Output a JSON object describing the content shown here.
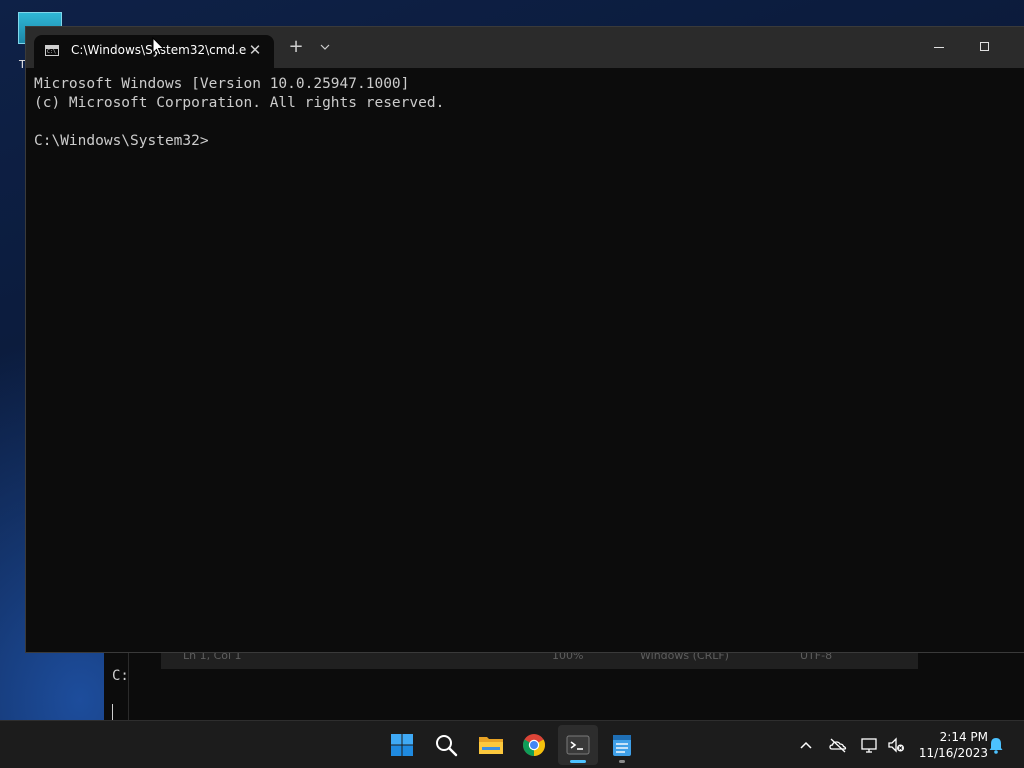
{
  "desktop": {
    "icon_label": "T"
  },
  "background": {
    "cmd_prompt": "C:",
    "notepad_status": {
      "position": "Ln 1, Col 1",
      "zoom": "100%",
      "line_ending": "Windows (CRLF)",
      "encoding": "UTF-8"
    }
  },
  "terminal": {
    "tab_title": "C:\\Windows\\System32\\cmd.e",
    "tab_icon_text": "C:\\",
    "close_tab_glyph": "✕",
    "new_tab_glyph": "+",
    "lines": [
      "Microsoft Windows [Version 10.0.25947.1000]",
      "(c) Microsoft Corporation. All rights reserved.",
      "",
      "C:\\Windows\\System32>"
    ]
  },
  "taskbar": {
    "icons": [
      "windows-start-icon",
      "search-icon",
      "file-explorer-icon",
      "chrome-icon",
      "terminal-icon",
      "notepad-icon"
    ],
    "time": "2:14 PM",
    "date": "11/16/2023"
  },
  "colors": {
    "accent": "#4cc2ff",
    "titlebar": "#2b2b2b",
    "console_bg": "#0c0c0c",
    "console_text": "#cccccc",
    "taskbar": "#1c1c1c"
  }
}
